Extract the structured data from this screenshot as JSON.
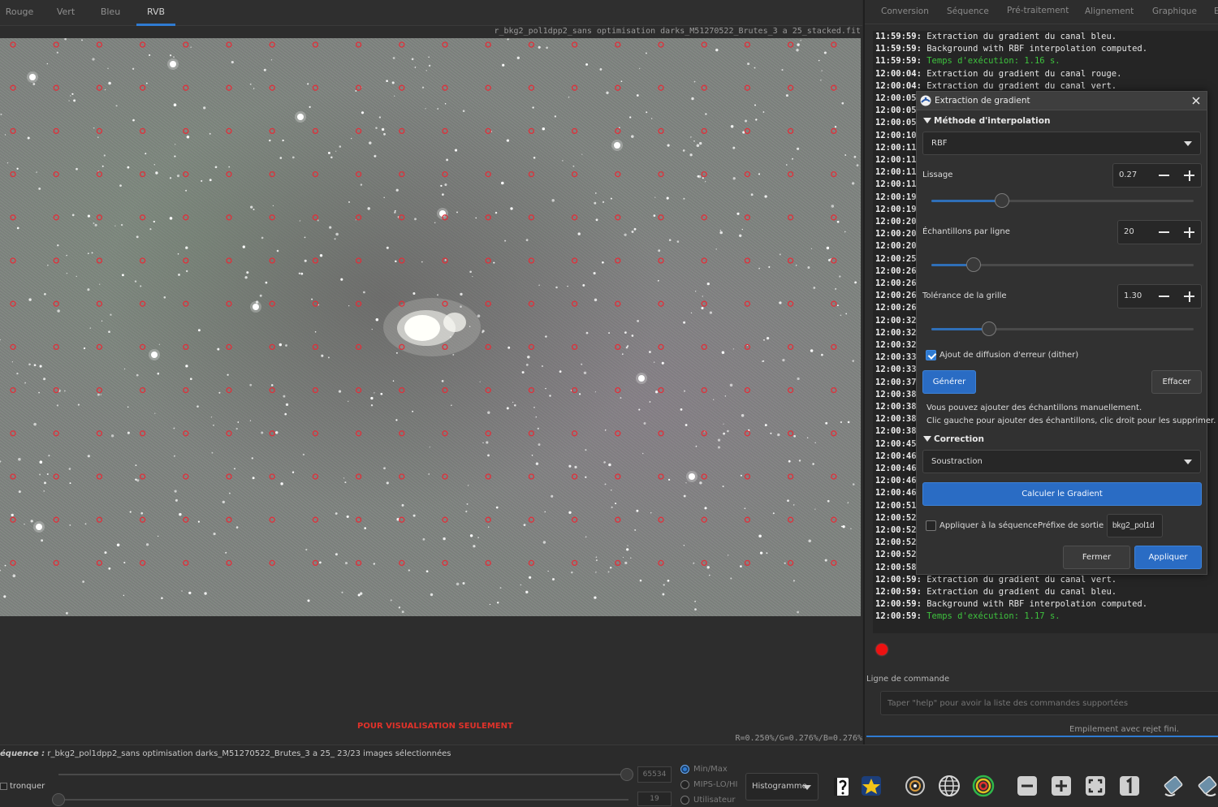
{
  "viewer": {
    "channel_tabs": [
      {
        "label": "Rouge",
        "active": false
      },
      {
        "label": "Vert",
        "active": false
      },
      {
        "label": "Bleu",
        "active": false
      },
      {
        "label": "RVB",
        "active": true
      }
    ],
    "file_name": "r_bkg2_pol1dpp2_sans optimisation darks_M51270522_Brutes_3 a 25_stacked.fit",
    "watermark": "POUR VISUALISATION SEULEMENT",
    "pixel_values": "R=0.250%/G=0.276%/B=0.276%"
  },
  "bottom": {
    "sequence_label": "équence :",
    "sequence_value": " r_bkg2_pol1dpp2_sans optimisation darks_M51270522_Brutes_3 a 25_ 23/23 images sélectionnées",
    "truncate_label": "tronquer",
    "max_value": "65534",
    "min_value": "19",
    "modes": [
      {
        "label": "Min/Max",
        "selected": true
      },
      {
        "label": "MIPS-LO/HI",
        "selected": false
      },
      {
        "label": "Utilisateur",
        "selected": false
      }
    ],
    "display_mode": "Histogramme",
    "toolbar_icons": [
      "image-stats-icon",
      "star-icon",
      "photometry-icon",
      "globe-icon",
      "target-icon",
      "zoom-out-icon",
      "zoom-in-icon",
      "fit-screen-icon",
      "zoom-1-icon",
      "rotate-left-icon",
      "rotate-right-icon"
    ]
  },
  "right_panel": {
    "tabs": [
      "Conversion",
      "Séquence",
      "Pré-traitement",
      "Alignement",
      "Graphique",
      "E"
    ],
    "console_lines": [
      {
        "ts": "11:59:59:",
        "msg": " Extraction du gradient du canal bleu.",
        "green": false
      },
      {
        "ts": "11:59:59:",
        "msg": " Background with RBF interpolation computed.",
        "green": false
      },
      {
        "ts": "11:59:59:",
        "msg": " Temps d'exécution: 1.16 s.",
        "green": true
      },
      {
        "ts": "12:00:04:",
        "msg": " Extraction du gradient du canal rouge.",
        "green": false
      },
      {
        "ts": "12:00:04:",
        "msg": " Extraction du gradient du canal vert.",
        "green": false
      },
      {
        "ts": "12:00:05",
        "msg": "",
        "green": false
      },
      {
        "ts": "12:00:05",
        "msg": "",
        "green": false
      },
      {
        "ts": "12:00:05",
        "msg": "",
        "green": false
      },
      {
        "ts": "12:00:10",
        "msg": "",
        "green": false
      },
      {
        "ts": "12:00:11",
        "msg": "",
        "green": false
      },
      {
        "ts": "12:00:11",
        "msg": "",
        "green": false
      },
      {
        "ts": "12:00:11",
        "msg": "",
        "green": false
      },
      {
        "ts": "12:00:11",
        "msg": "",
        "green": false
      },
      {
        "ts": "12:00:19",
        "msg": "",
        "green": false
      },
      {
        "ts": "12:00:19",
        "msg": "",
        "green": false
      },
      {
        "ts": "12:00:20",
        "msg": "",
        "green": false
      },
      {
        "ts": "12:00:20",
        "msg": "",
        "green": false
      },
      {
        "ts": "12:00:20",
        "msg": "",
        "green": false
      },
      {
        "ts": "12:00:25",
        "msg": "",
        "green": false
      },
      {
        "ts": "12:00:26",
        "msg": "",
        "green": false
      },
      {
        "ts": "12:00:26",
        "msg": "",
        "green": false
      },
      {
        "ts": "12:00:26",
        "msg": "",
        "green": false
      },
      {
        "ts": "12:00:26",
        "msg": "",
        "green": false
      },
      {
        "ts": "12:00:32",
        "msg": "",
        "green": false
      },
      {
        "ts": "12:00:32",
        "msg": "",
        "green": false
      },
      {
        "ts": "12:00:32",
        "msg": "",
        "green": false
      },
      {
        "ts": "12:00:33",
        "msg": "",
        "green": false
      },
      {
        "ts": "12:00:33",
        "msg": "",
        "green": false
      },
      {
        "ts": "12:00:37",
        "msg": "",
        "green": false
      },
      {
        "ts": "12:00:38",
        "msg": "",
        "green": false
      },
      {
        "ts": "12:00:38",
        "msg": "",
        "green": false
      },
      {
        "ts": "12:00:38",
        "msg": "",
        "green": false
      },
      {
        "ts": "12:00:38",
        "msg": "",
        "green": false
      },
      {
        "ts": "12:00:45",
        "msg": "",
        "green": false
      },
      {
        "ts": "12:00:46",
        "msg": "",
        "green": false
      },
      {
        "ts": "12:00:46",
        "msg": "",
        "green": false
      },
      {
        "ts": "12:00:46",
        "msg": "",
        "green": false
      },
      {
        "ts": "12:00:46",
        "msg": "",
        "green": false
      },
      {
        "ts": "12:00:51",
        "msg": "",
        "green": false
      },
      {
        "ts": "12:00:52",
        "msg": "",
        "green": false
      },
      {
        "ts": "12:00:52",
        "msg": "",
        "green": false
      },
      {
        "ts": "12:00:52",
        "msg": "",
        "green": false
      },
      {
        "ts": "12:00:52",
        "msg": "",
        "green": false
      },
      {
        "ts": "12:00:58",
        "msg": "",
        "green": false
      },
      {
        "ts": "12:00:59:",
        "msg": " Extraction du gradient du canal vert.",
        "green": false
      },
      {
        "ts": "12:00:59:",
        "msg": " Extraction du gradient du canal bleu.",
        "green": false
      },
      {
        "ts": "12:00:59:",
        "msg": " Background with RBF interpolation computed.",
        "green": false
      },
      {
        "ts": "12:00:59:",
        "msg": " Temps d'exécution: 1.17 s.",
        "green": true
      }
    ],
    "cmd_label": "Ligne de commande",
    "cmd_placeholder": "Taper \"help\" pour avoir la liste des commandes supportées",
    "status": "Empilement avec rejet fini."
  },
  "dialog": {
    "title": "Extraction de gradient",
    "interp_header": "Méthode d'interpolation",
    "interp_value": "RBF",
    "smoothing": {
      "label": "Lissage",
      "value": "0.27",
      "fraction": 0.27
    },
    "samples": {
      "label": "Échantillons par ligne",
      "value": "20",
      "fraction": 0.16
    },
    "tolerance": {
      "label": "Tolérance de la grille",
      "value": "1.30",
      "fraction": 0.22
    },
    "dither": {
      "label": "Ajout de diffusion d'erreur (dither)",
      "checked": true
    },
    "generate_label": "Générer",
    "clear_label": "Effacer",
    "info_line1": "Vous pouvez ajouter des échantillons manuellement.",
    "info_line2": "Clic gauche pour ajouter des échantillons, clic droit pour les supprimer.",
    "correction_header": "Correction",
    "correction_value": "Soustraction",
    "compute_label": "Calculer le Gradient",
    "apply_seq": {
      "label": "Appliquer à la séquence",
      "checked": false
    },
    "prefix_label": "Préfixe de sortie :",
    "prefix_value": "bkg2_pol1d",
    "close_label": "Fermer",
    "apply_label": "Appliquer"
  },
  "colors": {
    "accent": "#2f7bd2",
    "sample_marker": "#e0303a",
    "log_green": "#3ec23e",
    "status_dot": "#e11111"
  }
}
